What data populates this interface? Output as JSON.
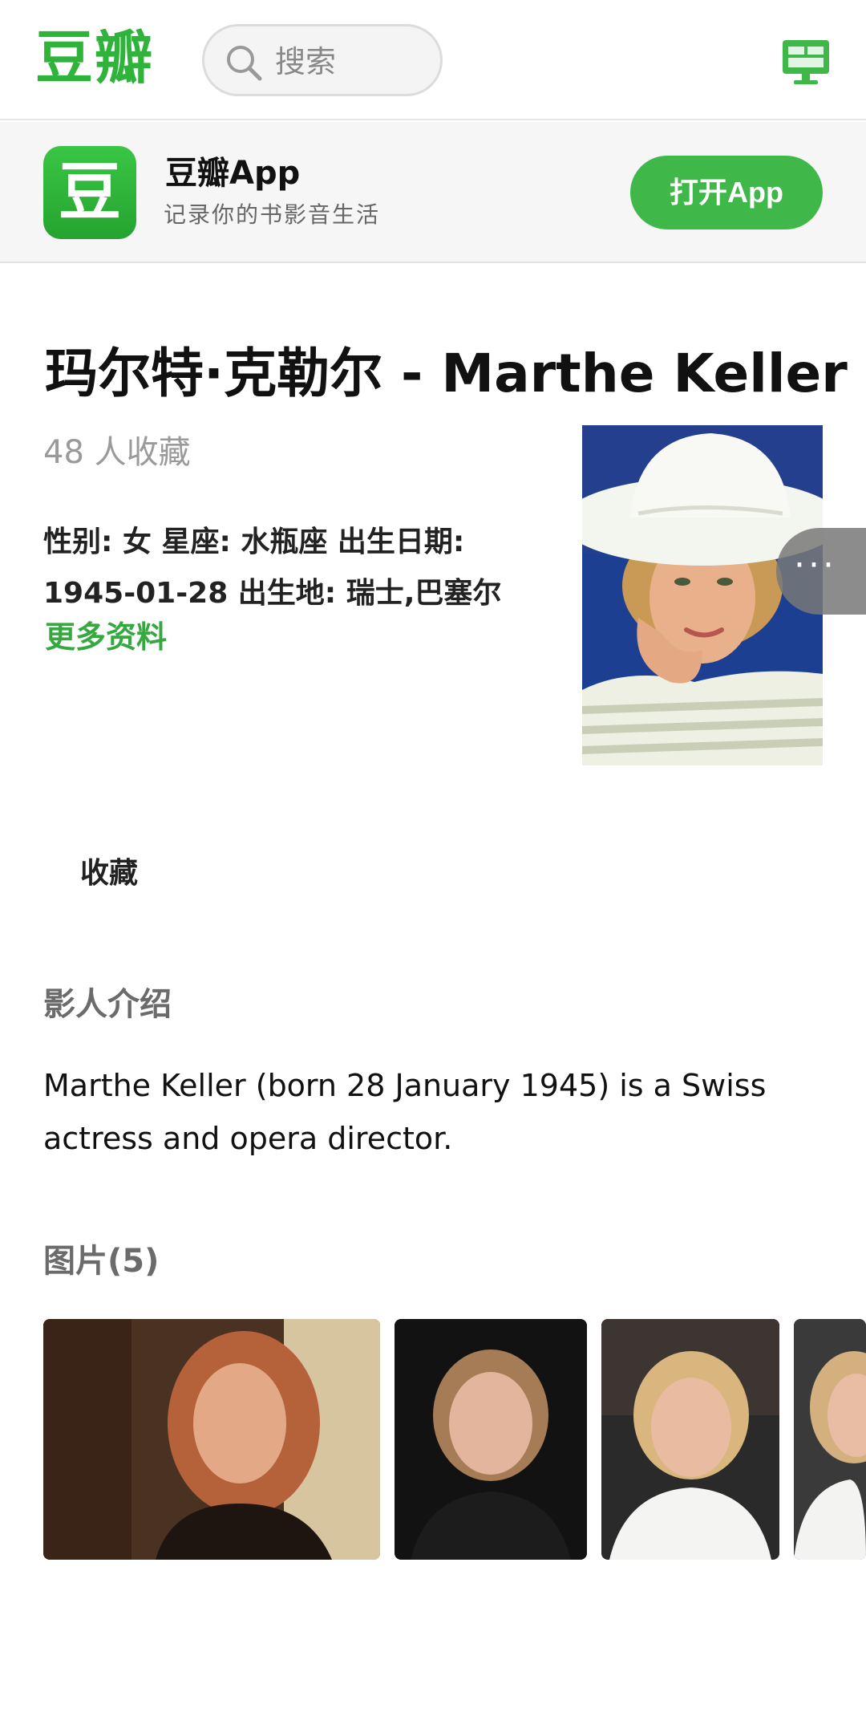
{
  "header": {
    "logo": "豆瓣",
    "search_placeholder": "搜索",
    "icons": {
      "search": "search-icon",
      "desktop": "desktop-icon"
    }
  },
  "banner": {
    "app_icon_char": "豆",
    "app_name": "豆瓣App",
    "slogan": "记录你的书影音生活",
    "open_button": "打开App"
  },
  "celebrity": {
    "title": "玛尔特·克勒尔 - Marthe Keller",
    "collect_count": "48 人收藏",
    "info_line1": "性别: 女 星座: 水瓶座 出生日期:",
    "info_line2": "1945-01-28 出生地: 瑞士,巴塞尔",
    "more_info": "更多资料",
    "more_bubble": "···",
    "collect_button": "收藏"
  },
  "intro": {
    "heading": "影人介绍",
    "text": "Marthe Keller (born 28 January 1945) is a Swiss actress and opera director."
  },
  "photos": {
    "heading": "图片(5)",
    "count": 5
  },
  "colors": {
    "brand_green": "#2fb33a",
    "button_green": "#3fb849",
    "link_green": "#36a840"
  }
}
